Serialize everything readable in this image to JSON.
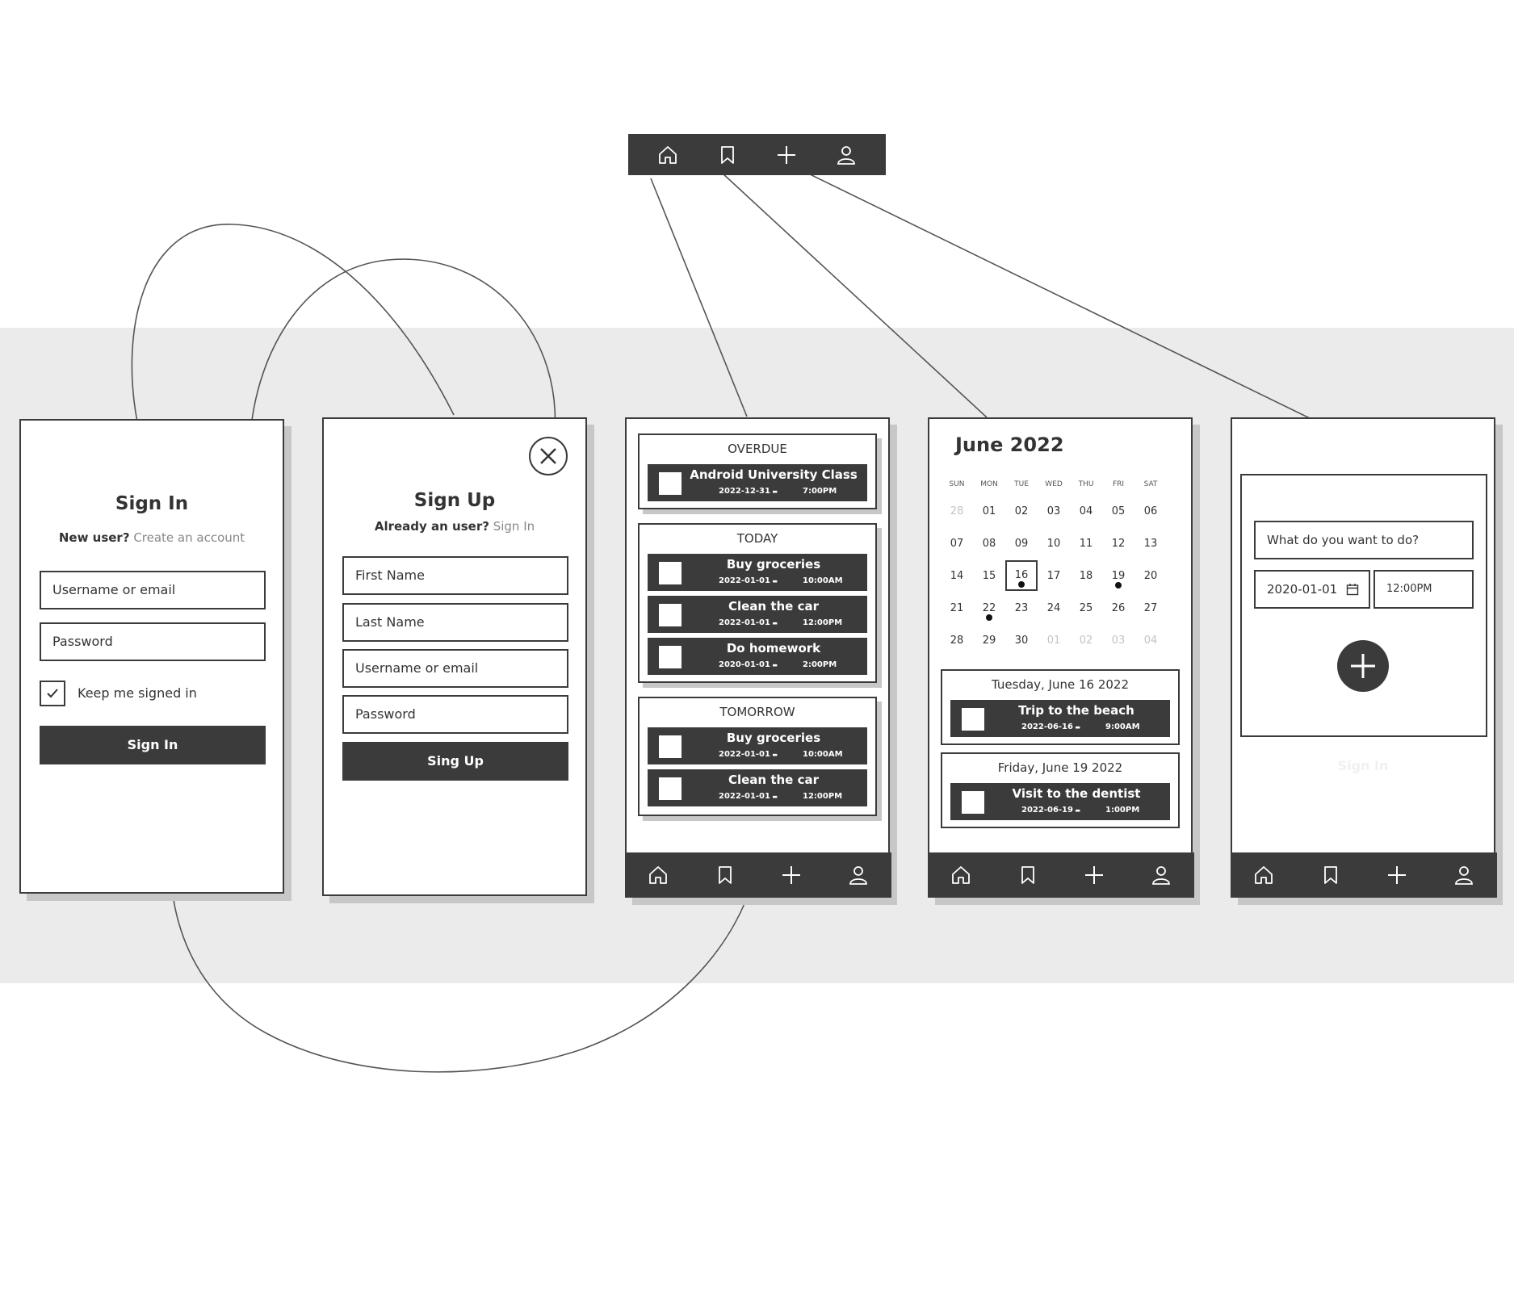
{
  "colors": {
    "dark": "#3b3b3b",
    "band": "#ebebeb",
    "shadow": "#c7c7c7",
    "muted_text": "#888888"
  },
  "nav_icons": [
    "home-icon",
    "bookmark-icon",
    "plus-icon",
    "profile-icon"
  ],
  "signin": {
    "title": "Sign In",
    "new_user": "New user?",
    "create_link": "Create an account",
    "username_placeholder": "Username or email",
    "password_placeholder": "Password",
    "keep_signed_in": "Keep me signed in",
    "button": "Sign In"
  },
  "signup": {
    "title": "Sign Up",
    "already_user": "Already an user?",
    "signin_link": "Sign In",
    "first_name": "First Name",
    "last_name": "Last Name",
    "username": "Username or email",
    "password": "Password",
    "button": "Sing Up"
  },
  "home": {
    "overdue": {
      "label": "OVERDUE",
      "tasks": [
        {
          "name": "Android University Class",
          "date": "2022-12-31",
          "time": "7:00PM"
        }
      ]
    },
    "today": {
      "label": "TODAY",
      "tasks": [
        {
          "name": "Buy groceries",
          "date": "2022-01-01",
          "time": "10:00AM"
        },
        {
          "name": "Clean the car",
          "date": "2022-01-01",
          "time": "12:00PM"
        },
        {
          "name": "Do homework",
          "date": "2020-01-01",
          "time": "2:00PM"
        }
      ]
    },
    "tomorrow": {
      "label": "TOMORROW",
      "tasks": [
        {
          "name": "Buy groceries",
          "date": "2022-01-01",
          "time": "10:00AM"
        },
        {
          "name": "Clean the car",
          "date": "2022-01-01",
          "time": "12:00PM"
        }
      ]
    }
  },
  "calendar": {
    "month": "June 2022",
    "weekdays": [
      "SUN",
      "MON",
      "TUE",
      "WED",
      "THU",
      "FRI",
      "SAT"
    ],
    "weeks": [
      [
        "28",
        "01",
        "02",
        "03",
        "04",
        "05",
        "06"
      ],
      [
        "07",
        "08",
        "09",
        "10",
        "11",
        "12",
        "13"
      ],
      [
        "14",
        "15",
        "16",
        "17",
        "18",
        "19",
        "20"
      ],
      [
        "21",
        "22",
        "23",
        "24",
        "25",
        "26",
        "27"
      ],
      [
        "28",
        "29",
        "30",
        "01",
        "02",
        "03",
        "04"
      ]
    ],
    "day1": {
      "heading": "Tuesday, June 16 2022",
      "task": {
        "name": "Trip to the beach",
        "date": "2022-06-16",
        "time": "9:00AM"
      }
    },
    "day2": {
      "heading": "Friday, June 19 2022",
      "task": {
        "name": "Visit to the dentist",
        "date": "2022-06-19",
        "time": "1:00PM"
      }
    }
  },
  "add": {
    "prompt_placeholder": "What do you want to do?",
    "date_value": "2020-01-01",
    "time_value": "12:00PM",
    "faint_label": "Sign In"
  }
}
